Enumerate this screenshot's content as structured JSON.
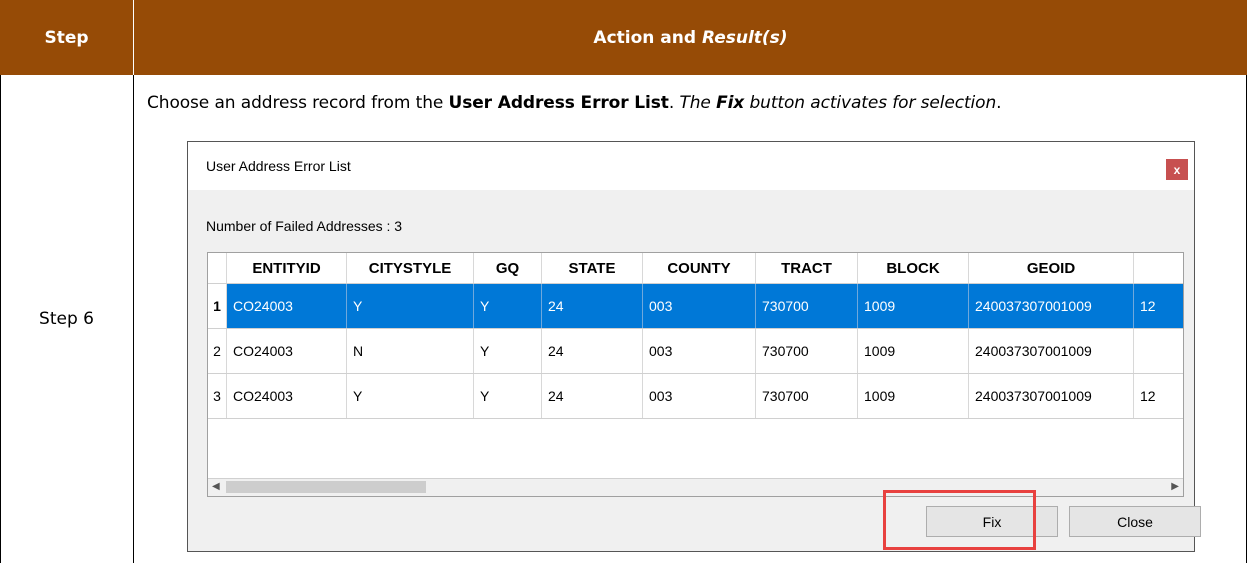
{
  "header": {
    "step": "Step",
    "action": "Action and ",
    "result": "Result(s)"
  },
  "step_label": "Step 6",
  "instruction": {
    "pre": "Choose an address record from the ",
    "list_name": "User Address Error List",
    "dot": ". ",
    "result_pre": "The ",
    "result_fix": "Fix",
    "result_post": " button activates for selection",
    "end": "."
  },
  "dialog": {
    "title": "User Address Error List",
    "close_glyph": "x",
    "failed_count_text": "Number of Failed Addresses : 3",
    "columns": [
      "ENTITYID",
      "CITYSTYLE",
      "GQ",
      "STATE",
      "COUNTY",
      "TRACT",
      "BLOCK",
      "GEOID"
    ],
    "rows": [
      {
        "num": "1",
        "cells": [
          "CO24003",
          "Y",
          "Y",
          "24",
          "003",
          "730700",
          "1009",
          "240037307001009"
        ],
        "extra": "12",
        "selected": true
      },
      {
        "num": "2",
        "cells": [
          "CO24003",
          "N",
          "Y",
          "24",
          "003",
          "730700",
          "1009",
          "240037307001009"
        ],
        "extra": "",
        "selected": false
      },
      {
        "num": "3",
        "cells": [
          "CO24003",
          "Y",
          "Y",
          "24",
          "003",
          "730700",
          "1009",
          "240037307001009"
        ],
        "extra": "12",
        "selected": false
      }
    ],
    "buttons": {
      "fix": "Fix",
      "close": "Close"
    },
    "scroll_left": "◀",
    "scroll_right": "▶"
  },
  "colors": {
    "header_bg": "#964B06",
    "selection": "#0078d7",
    "highlight": "#e8413f",
    "close_btn": "#c75050"
  }
}
